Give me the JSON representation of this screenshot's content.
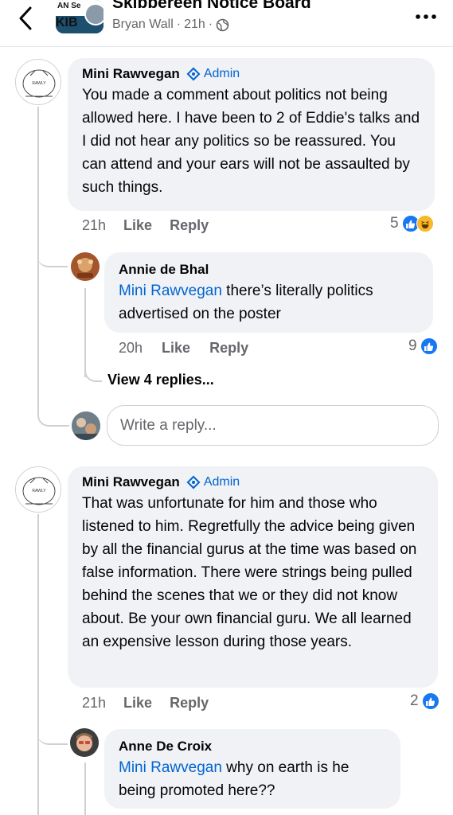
{
  "header": {
    "title": "Skibbereen Notice Board",
    "author": "Bryan Wall",
    "time": "21h",
    "separator": "·",
    "avatar_text_top": "AN  Se",
    "avatar_text_main": "KIB"
  },
  "comments": [
    {
      "author": "Mini Rawvegan",
      "badge": "Admin",
      "text": "You made a comment about politics not being allowed here. I have been to 2 of Eddie's talks and I did not hear any politics so be reassured. You can attend and your ears will not be assaulted by such things.",
      "time": "21h",
      "like_label": "Like",
      "reply_label": "Reply",
      "reaction_count": "5",
      "reactions": [
        "like-icon",
        "haha-icon"
      ],
      "replies": [
        {
          "author": "Annie de Bhal",
          "mention": "Mini Rawvegan",
          "text": " there’s literally politics advertised on the poster",
          "time": "20h",
          "like_label": "Like",
          "reply_label": "Reply",
          "reaction_count": "9"
        }
      ],
      "view_replies": "View 4 replies...",
      "reply_placeholder": "Write a reply..."
    },
    {
      "author": "Mini Rawvegan",
      "badge": "Admin",
      "text": "That was unfortunate for him and those who listened to him. Regretfully the advice being given by all the financial gurus at the time was based on false information. There were strings being pulled behind the scenes that we or they did not know about. Be your own financial guru. We all learned an expensive lesson during those years.",
      "time": "21h",
      "like_label": "Like",
      "reply_label": "Reply",
      "reaction_count": "2",
      "replies": [
        {
          "author": "Anne De Croix",
          "mention": "Mini Rawvegan",
          "text": " why on earth is he being promoted here??"
        }
      ]
    }
  ],
  "colors": {
    "accent": "#0064d1",
    "like_blue": "#1877f2",
    "bubble": "#f0f2f5",
    "secondary_text": "#65676b"
  }
}
